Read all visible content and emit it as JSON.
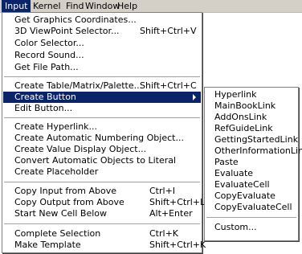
{
  "menubar": {
    "items": [
      {
        "label": "Input"
      },
      {
        "label": "Kernel"
      },
      {
        "label": "Find"
      },
      {
        "label": "Window"
      },
      {
        "label": "Help"
      }
    ]
  },
  "input_menu": {
    "items": [
      {
        "label": "Get Graphics Coordinates...",
        "shortcut": ""
      },
      {
        "label": "3D ViewPoint Selector...",
        "shortcut": "Shift+Ctrl+V"
      },
      {
        "label": "Color Selector...",
        "shortcut": ""
      },
      {
        "label": "Record Sound...",
        "shortcut": ""
      },
      {
        "label": "Get File Path...",
        "shortcut": ""
      },
      {
        "label": "Create Table/Matrix/Palette...",
        "shortcut": "Shift+Ctrl+C"
      },
      {
        "label": "Create Button",
        "shortcut": ""
      },
      {
        "label": "Edit Button...",
        "shortcut": ""
      },
      {
        "label": "Create Hyperlink...",
        "shortcut": ""
      },
      {
        "label": "Create Automatic Numbering Object...",
        "shortcut": ""
      },
      {
        "label": "Create Value Display Object...",
        "shortcut": ""
      },
      {
        "label": "Convert Automatic Objects to Literal",
        "shortcut": ""
      },
      {
        "label": "Create Placeholder",
        "shortcut": ""
      },
      {
        "label": "Copy Input from Above",
        "shortcut": "Ctrl+I"
      },
      {
        "label": "Copy Output from Above",
        "shortcut": "Shift+Ctrl+L"
      },
      {
        "label": "Start New Cell Below",
        "shortcut": "Alt+Enter"
      },
      {
        "label": "Complete Selection",
        "shortcut": "Ctrl+K"
      },
      {
        "label": "Make Template",
        "shortcut": "Shift+Ctrl+K"
      }
    ]
  },
  "create_button_submenu": {
    "items": [
      {
        "label": "Hyperlink"
      },
      {
        "label": "MainBookLink"
      },
      {
        "label": "AddOnsLink"
      },
      {
        "label": "RefGuideLink"
      },
      {
        "label": "GettingStartedLink"
      },
      {
        "label": "OtherInformationLink"
      },
      {
        "label": "Paste"
      },
      {
        "label": "Evaluate"
      },
      {
        "label": "EvaluateCell"
      },
      {
        "label": "CopyEvaluate"
      },
      {
        "label": "CopyEvaluateCell"
      },
      {
        "label": "Custom..."
      }
    ]
  }
}
